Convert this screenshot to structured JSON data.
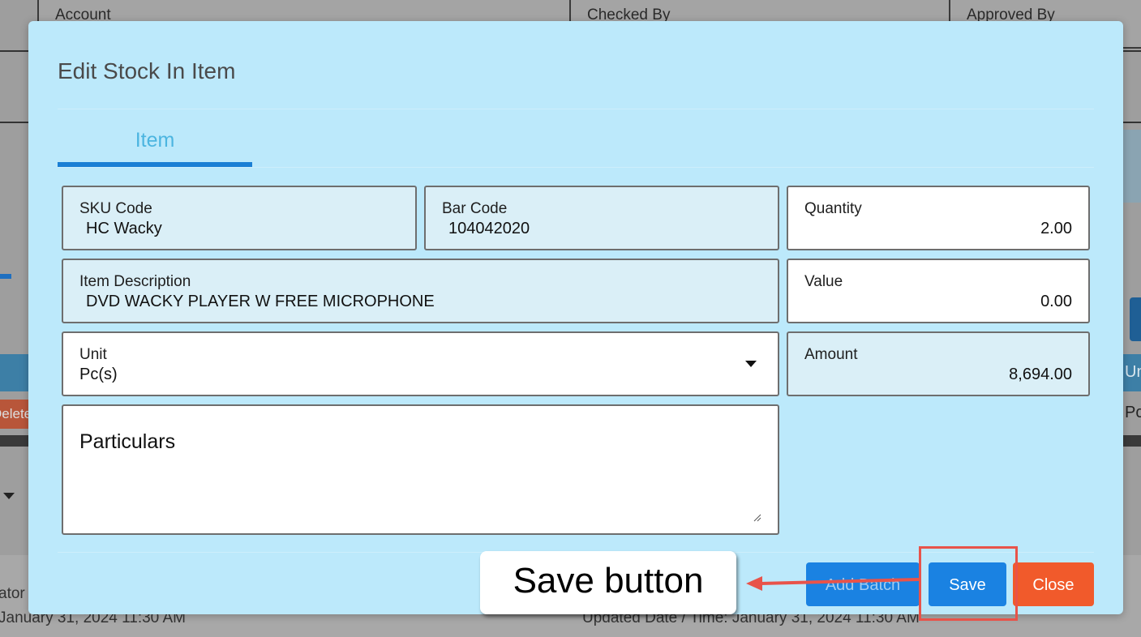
{
  "background": {
    "fields": [
      "Account",
      "Checked By",
      "Approved By"
    ],
    "delete_text": "Delete",
    "unit_header": "Un",
    "unit_value": "Pc",
    "footer_left_prefix": "ator",
    "footer_left_date": "January 31, 2024 11:30 AM",
    "footer_right_date": "Updated Date / Time: January 31, 2024 11:30 AM"
  },
  "modal": {
    "title": "Edit Stock In Item",
    "tab_item": "Item",
    "fields": {
      "sku": {
        "label": "SKU Code",
        "value": "HC Wacky"
      },
      "barcode": {
        "label": "Bar Code",
        "value": "104042020"
      },
      "quantity": {
        "label": "Quantity",
        "value": "2.00"
      },
      "description": {
        "label": "Item Description",
        "value": "DVD WACKY PLAYER W FREE MICROPHONE"
      },
      "value": {
        "label": "Value",
        "value": "0.00"
      },
      "unit": {
        "label": "Unit",
        "value": "Pc(s)"
      },
      "amount": {
        "label": "Amount",
        "value": "8,694.00"
      },
      "particulars": {
        "label": "Particulars",
        "value": ""
      }
    },
    "buttons": {
      "add_batch": "Add Batch",
      "save": "Save",
      "close": "Close"
    }
  },
  "annotation": {
    "callout": "Save button",
    "highlight_color": "#e8534a"
  }
}
